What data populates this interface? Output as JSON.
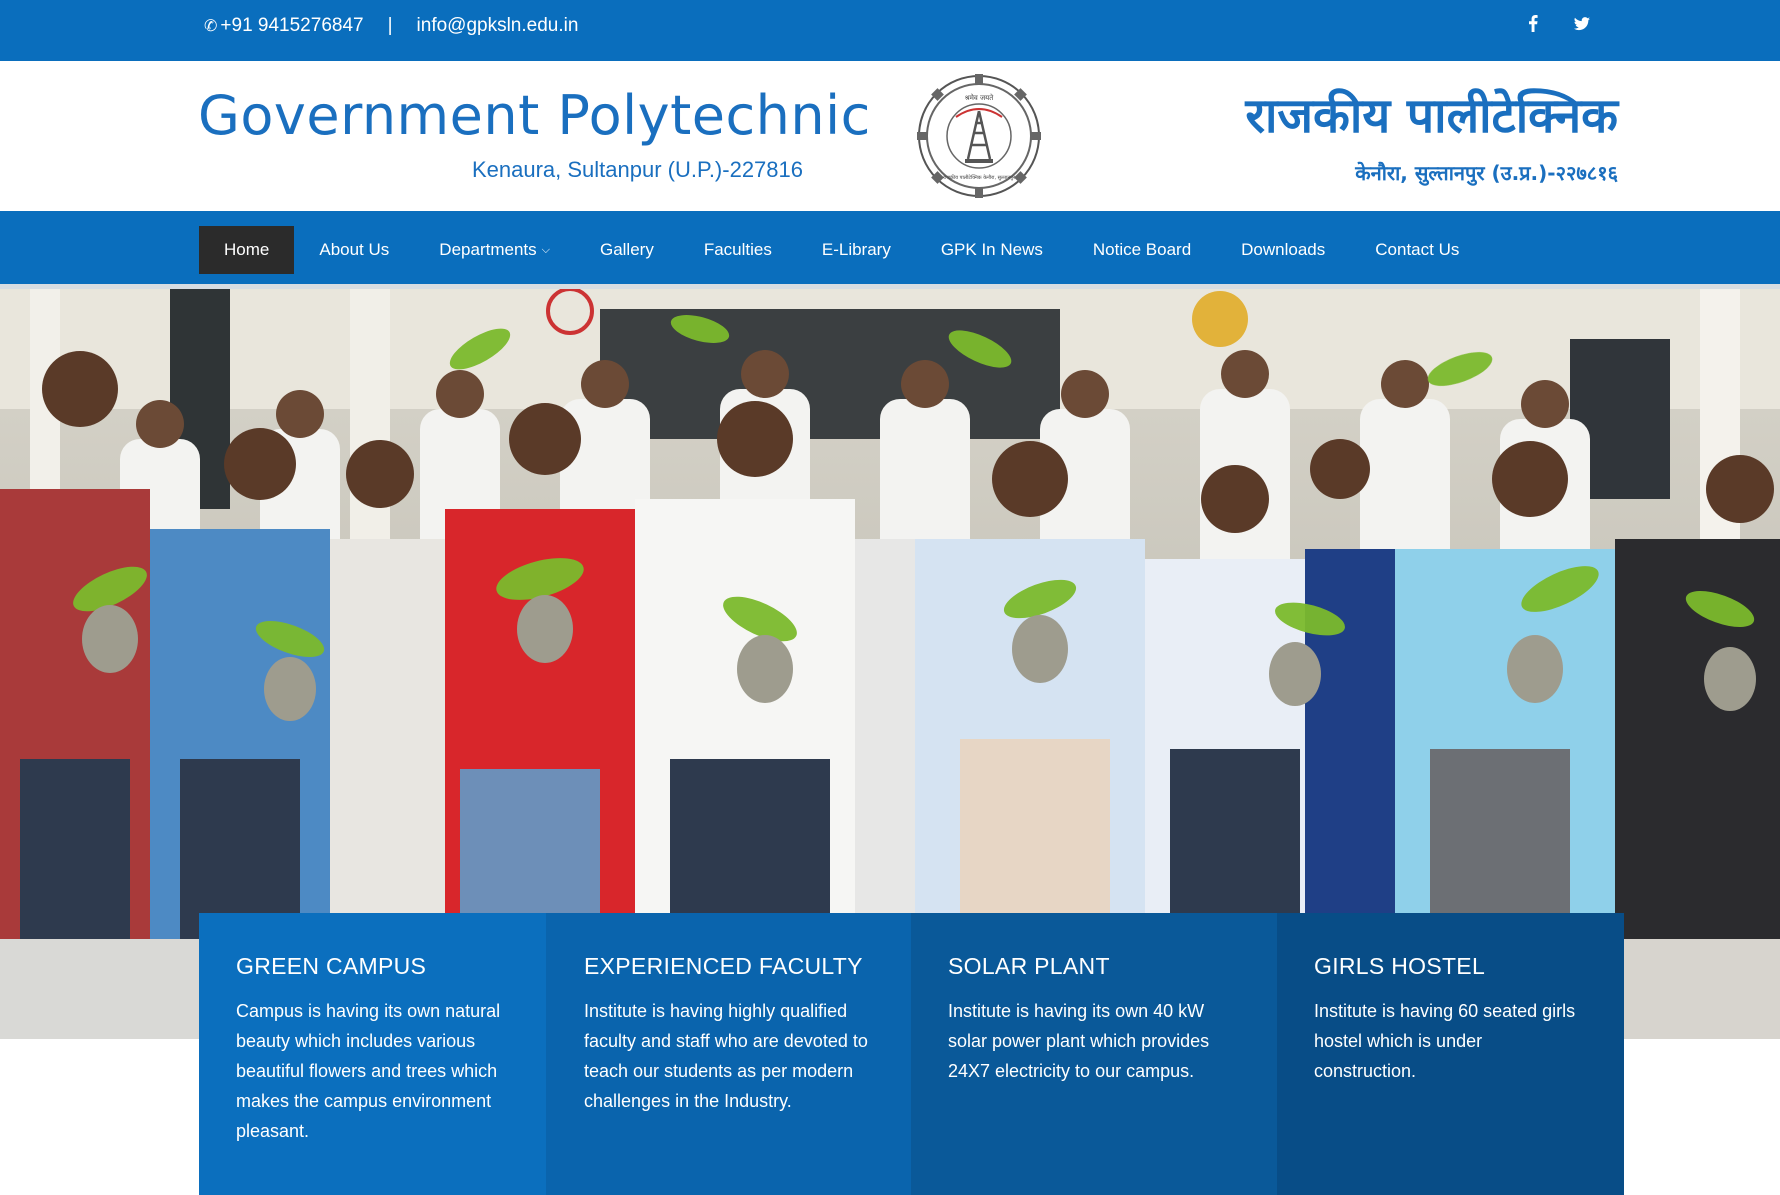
{
  "topbar": {
    "phone": "+91 9415276847",
    "separator": "|",
    "email": "info@gpksln.edu.in",
    "phone_icon": "phone-icon",
    "social": [
      {
        "name": "facebook-icon",
        "glyph": "f"
      },
      {
        "name": "twitter-icon",
        "glyph": "t"
      }
    ]
  },
  "header": {
    "title_en": "Government Polytechnic",
    "address_en": "Kenaura, Sultanpur (U.P.)-227816",
    "title_hi": "राजकीय पालीटेक्निक",
    "address_hi": "केनौरा, सुल्तानपुर (उ.प्र.)-२२७८१६",
    "seal_text_top": "श्रमेव जयते",
    "seal_text_bottom": "राजकीय पालीटेक्निक केनौरा, सुल्तानपुर"
  },
  "nav": {
    "items": [
      {
        "label": "Home",
        "active": true
      },
      {
        "label": "About Us"
      },
      {
        "label": "Departments",
        "dropdown": true
      },
      {
        "label": "Gallery"
      },
      {
        "label": "Faculties"
      },
      {
        "label": "E-Library"
      },
      {
        "label": "GPK In News"
      },
      {
        "label": "Notice Board"
      },
      {
        "label": "Downloads"
      },
      {
        "label": "Contact Us"
      }
    ]
  },
  "hero": {
    "image": "group-photo-of-students-and-staff-holding-saplings"
  },
  "features": [
    {
      "title": "GREEN CAMPUS",
      "text": "Campus is having its own natural beauty which includes various beautiful flowers and trees which makes the campus environment pleasant."
    },
    {
      "title": "EXPERIENCED FACULTY",
      "text": "Institute is having highly qualified faculty and staff who are devoted to teach our students as per modern challenges in the Industry."
    },
    {
      "title": "SOLAR PLANT",
      "text": "Institute is having its own 40 kW solar power plant which provides 24X7 electricity to our campus."
    },
    {
      "title": "GIRLS HOSTEL",
      "text": "Institute is having 60 seated girls hostel which is under construction."
    }
  ],
  "colors": {
    "primary": "#0a6ebd",
    "nav_active": "#2b2b2b",
    "brand_text": "#1a6fbf"
  }
}
